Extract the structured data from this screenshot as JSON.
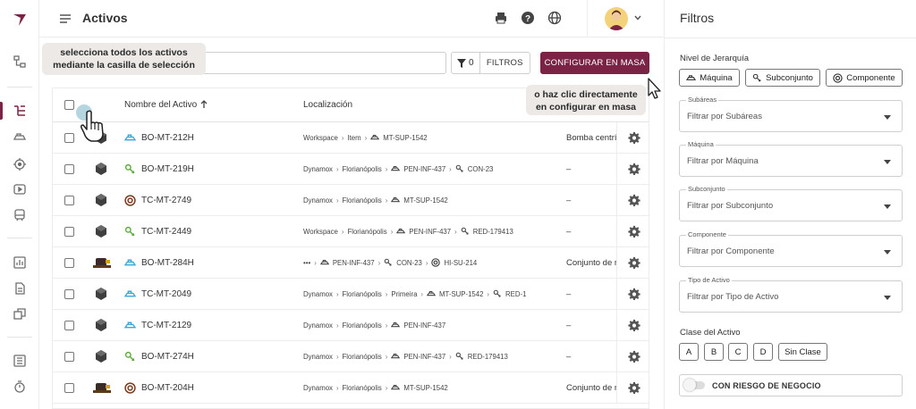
{
  "header": {
    "title": "Activos"
  },
  "toolbar": {
    "filter_count": "0",
    "filter_label": "FILTROS",
    "mass_config_label": "CONFIGURAR EN MASA"
  },
  "tooltips": {
    "select_all": "selecciona todos los activos mediante la casilla de selección",
    "mass_config": "o haz clic directamente en configurar en masa"
  },
  "table": {
    "columns": {
      "name": "Nombre del Activo",
      "location": "Localización"
    },
    "rows": [
      {
        "name": "BO-MT-212H",
        "type_icon": "machine-icon",
        "location": [
          "Workspace",
          "Item",
          "MT-SUP-1542"
        ],
        "location_icons": [
          null,
          null,
          "machine-icon"
        ],
        "description": "Bomba centrífuga"
      },
      {
        "name": "BO-MT-219H",
        "type_icon": "subassembly-icon",
        "location": [
          "Dynamox",
          "Florianópolis",
          "PEN-INF-437",
          "CON-23"
        ],
        "location_icons": [
          null,
          null,
          "machine-icon",
          "subassembly-icon"
        ],
        "description": "–"
      },
      {
        "name": "TC-MT-2749",
        "type_icon": "component-icon",
        "location": [
          "Dynamox",
          "Florianópolis",
          "MT-SUP-1542"
        ],
        "location_icons": [
          null,
          null,
          "machine-icon"
        ],
        "description": "–"
      },
      {
        "name": "TC-MT-2449",
        "type_icon": "subassembly-icon",
        "location": [
          "Workspace",
          "Florianópolis",
          "PEN-INF-437",
          "RED-179413"
        ],
        "location_icons": [
          null,
          null,
          "machine-icon",
          "subassembly-icon"
        ],
        "description": "–"
      },
      {
        "name": "BO-MT-284H",
        "type_icon": "machine-icon",
        "location": [
          "•••",
          "PEN-INF-437",
          "CON-23",
          "HI-SU-214"
        ],
        "location_icons": [
          null,
          "machine-icon",
          "subassembly-icon",
          "component-icon"
        ],
        "description": "Conjunto de motor"
      },
      {
        "name": "TC-MT-2049",
        "type_icon": "machine-icon",
        "location": [
          "Dynamox",
          "Florianópolis",
          "Primeira",
          "MT-SUP-1542",
          "RED-1"
        ],
        "location_icons": [
          null,
          null,
          null,
          "machine-icon",
          "subassembly-icon"
        ],
        "description": "–"
      },
      {
        "name": "TC-MT-2129",
        "type_icon": "machine-icon",
        "location": [
          "Dynamox",
          "Florianópolis",
          "PEN-INF-437"
        ],
        "location_icons": [
          null,
          null,
          "machine-icon"
        ],
        "description": "–"
      },
      {
        "name": "BO-MT-274H",
        "type_icon": "subassembly-icon",
        "location": [
          "Dynamox",
          "Florianópolis",
          "PEN-INF-437",
          "RED-179413"
        ],
        "location_icons": [
          null,
          null,
          "machine-icon",
          "subassembly-icon"
        ],
        "description": "–"
      },
      {
        "name": "BO-MT-204H",
        "type_icon": "component-icon",
        "location": [
          "Dynamox",
          "Florianópolis",
          "MT-SUP-1542"
        ],
        "location_icons": [
          null,
          null,
          "machine-icon"
        ],
        "description": "Conjunto de motor"
      }
    ]
  },
  "filters": {
    "title": "Filtros",
    "hierarchy_label": "Nivel de Jerarquía",
    "hierarchy_options": [
      "Máquina",
      "Subconjunto",
      "Componente"
    ],
    "selects": [
      {
        "label": "Subáreas",
        "placeholder": "Filtrar por Subáreas"
      },
      {
        "label": "Máquina",
        "placeholder": "Filtrar por Máquina"
      },
      {
        "label": "Subconjunto",
        "placeholder": "Filtrar por Subconjunto"
      },
      {
        "label": "Componente",
        "placeholder": "Filtrar por Componente"
      },
      {
        "label": "Tipo de Activo",
        "placeholder": "Filtrar por Tipo de Activo"
      }
    ],
    "class_label": "Clase del Activo",
    "class_options": [
      "A",
      "B",
      "C",
      "D",
      "Sin Clase"
    ],
    "business_risk_label": "CON RIESGO DE NEGOCIO"
  },
  "colors": {
    "brand": "#7b2344",
    "machine_icon": "#3aa7d8",
    "subassembly_icon": "#5aa83a",
    "component_icon": "#7a3b1e"
  }
}
